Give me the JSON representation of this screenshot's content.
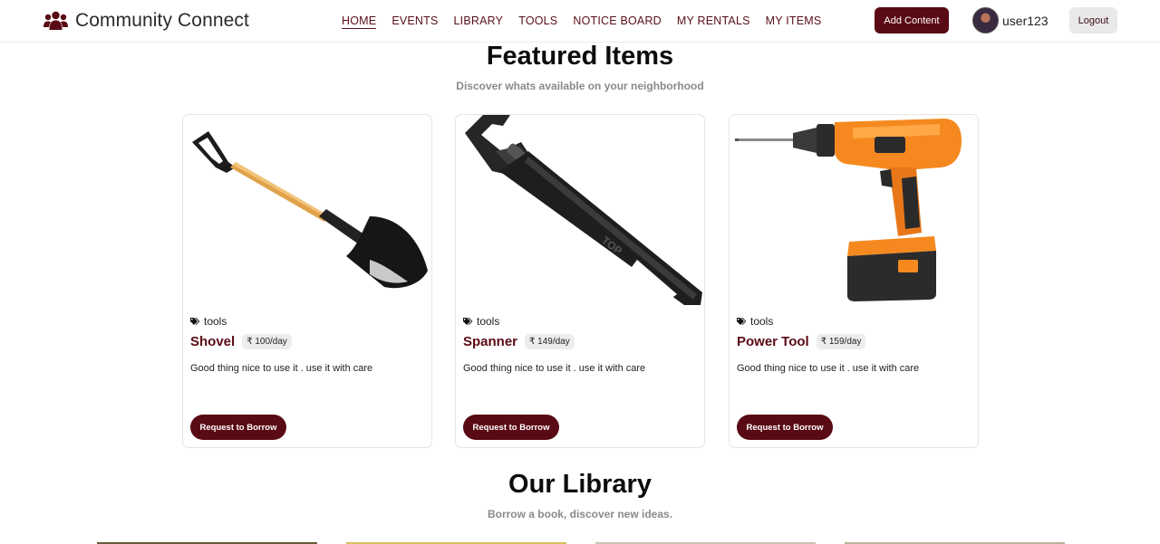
{
  "brand": {
    "name": "Community Connect",
    "icon": "users-icon"
  },
  "nav": {
    "links": [
      {
        "label": "HOME",
        "active": true
      },
      {
        "label": "EVENTS",
        "active": false
      },
      {
        "label": "LIBRARY",
        "active": false
      },
      {
        "label": "TOOLS",
        "active": false
      },
      {
        "label": "NOTICE BOARD",
        "active": false
      },
      {
        "label": "MY RENTALS",
        "active": false
      },
      {
        "label": "MY ITEMS",
        "active": false
      }
    ],
    "add_content_label": "Add Content",
    "username": "user123",
    "logout_label": "Logout"
  },
  "featured": {
    "title": "Featured Items",
    "subtitle": "Discover whats available on your neighborhood",
    "items": [
      {
        "image": "shovel",
        "category": "tools",
        "name": "Shovel",
        "price": "₹ 100/day",
        "description": "Good thing nice to use it . use it with care",
        "button_label": "Request to Borrow"
      },
      {
        "image": "spanner",
        "category": "tools",
        "name": "Spanner",
        "price": "₹ 149/day",
        "description": "Good thing nice to use it . use it with care",
        "button_label": "Request to Borrow"
      },
      {
        "image": "power-drill",
        "category": "tools",
        "name": "Power Tool",
        "price": "₹ 159/day",
        "description": "Good thing nice to use it . use it with care",
        "button_label": "Request to Borrow"
      }
    ]
  },
  "library": {
    "title": "Our Library",
    "subtitle": "Borrow a book, discover new ideas."
  },
  "colors": {
    "brand": "#5a0a14",
    "muted_text": "#8a8a8a",
    "drill_orange": "#f5891f"
  }
}
